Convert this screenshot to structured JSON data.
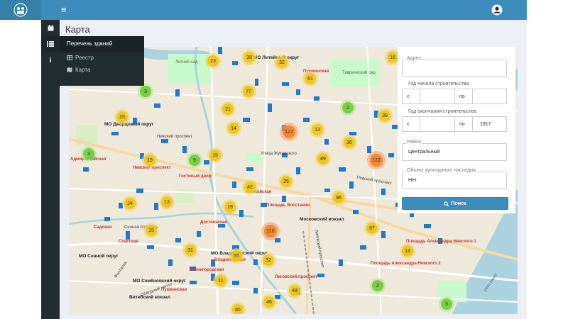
{
  "header": {
    "menu_icon": "hamburger-icon",
    "user_icon": "user-icon",
    "brand_color": "#3c8dbc"
  },
  "sidebar": {
    "icons": [
      "calendar-icon",
      "list-icon",
      "info-icon"
    ]
  },
  "flyout": {
    "title": "Перечень зданий",
    "items": [
      {
        "label": "Реестр",
        "icon": "table-icon"
      },
      {
        "label": "Карта",
        "icon": "map-icon"
      }
    ]
  },
  "page": {
    "title": "Карта"
  },
  "map": {
    "labels": {
      "l1": "Летний сад",
      "l2": "МО Литейный округ",
      "l3": "Пушкинская",
      "l4": "Таврический сад",
      "l5": "МО Дворцовый округ",
      "l6": "Невский проспект",
      "l7": "Адмиралтейская",
      "l8": "Невский проспект",
      "l9": "Гостиный двор",
      "l10": "Улица Жуковского",
      "l11": "Маяковская",
      "l12": "Площадь Восстания",
      "l13": "Московский вокзал",
      "l14": "Садовая",
      "l15": "Сенная площадь",
      "l16": "Спасская",
      "l17": "МО Сенной округ",
      "l18": "МО Владимирский округ",
      "l19": "Достоевская",
      "l20": "Владимирская",
      "l21": "Звенигородская",
      "l22": "МО Семёновский округ",
      "l23": "Витебский вокзал",
      "l24": "Пушкинская",
      "l25": "Лиговский проспект",
      "l26": "Площадь Александра Невского 1",
      "l27": "Площадь Александра Невского 2",
      "l28": "река Нева",
      "l29": "Лиговский проспект",
      "l30": "Обводный канал",
      "l31": "Фонтанка",
      "l32": "Невский проспект"
    },
    "clusters": [
      {
        "n": "38",
        "t": "y"
      },
      {
        "n": "32",
        "t": "y"
      },
      {
        "n": "23",
        "t": "y"
      },
      {
        "n": "61",
        "t": "y"
      },
      {
        "n": "16",
        "t": "y"
      },
      {
        "n": "77",
        "t": "y"
      },
      {
        "n": "3",
        "t": "g"
      },
      {
        "n": "2",
        "t": "g"
      },
      {
        "n": "21",
        "t": "y"
      },
      {
        "n": "39",
        "t": "y"
      },
      {
        "n": "25",
        "t": "y"
      },
      {
        "n": "14",
        "t": "y"
      },
      {
        "n": "127",
        "t": "o"
      },
      {
        "n": "13",
        "t": "y"
      },
      {
        "n": "30",
        "t": "y"
      },
      {
        "n": "3",
        "t": "g"
      },
      {
        "n": "15",
        "t": "y"
      },
      {
        "n": "19",
        "t": "y"
      },
      {
        "n": "9",
        "t": "g"
      },
      {
        "n": "89",
        "t": "y"
      },
      {
        "n": "122",
        "t": "o"
      },
      {
        "n": "25",
        "t": "y"
      },
      {
        "n": "42",
        "t": "y"
      },
      {
        "n": "24",
        "t": "y"
      },
      {
        "n": "13",
        "t": "y"
      },
      {
        "n": "96",
        "t": "y"
      },
      {
        "n": "19",
        "t": "y"
      },
      {
        "n": "15",
        "t": "y"
      },
      {
        "n": "110",
        "t": "o"
      },
      {
        "n": "87",
        "t": "y"
      },
      {
        "n": "31",
        "t": "y"
      },
      {
        "n": "55",
        "t": "y"
      },
      {
        "n": "32",
        "t": "y"
      },
      {
        "n": "14",
        "t": "y"
      },
      {
        "n": "11",
        "t": "y"
      },
      {
        "n": "2",
        "t": "g"
      },
      {
        "n": "48",
        "t": "y"
      },
      {
        "n": "46",
        "t": "y"
      },
      {
        "n": "85",
        "t": "y"
      },
      {
        "n": "3",
        "t": "g"
      }
    ]
  },
  "filters": {
    "address_label": "Адрес",
    "address_value": "",
    "build_start_label": "Год начала строительства",
    "build_start_from_prefix": "с",
    "build_start_from": "",
    "build_start_to_prefix": "по",
    "build_start_to": "",
    "build_end_label": "Год окончания строительства",
    "build_end_from_prefix": "с",
    "build_end_from": "",
    "build_end_to_prefix": "по",
    "build_end_to": "1917",
    "district_label": "Район",
    "district_value": "Центральный",
    "heritage_label": "Объект культурного наследия",
    "heritage_value": "Нет",
    "search_label": "Поиск",
    "search_icon": "search-icon"
  }
}
